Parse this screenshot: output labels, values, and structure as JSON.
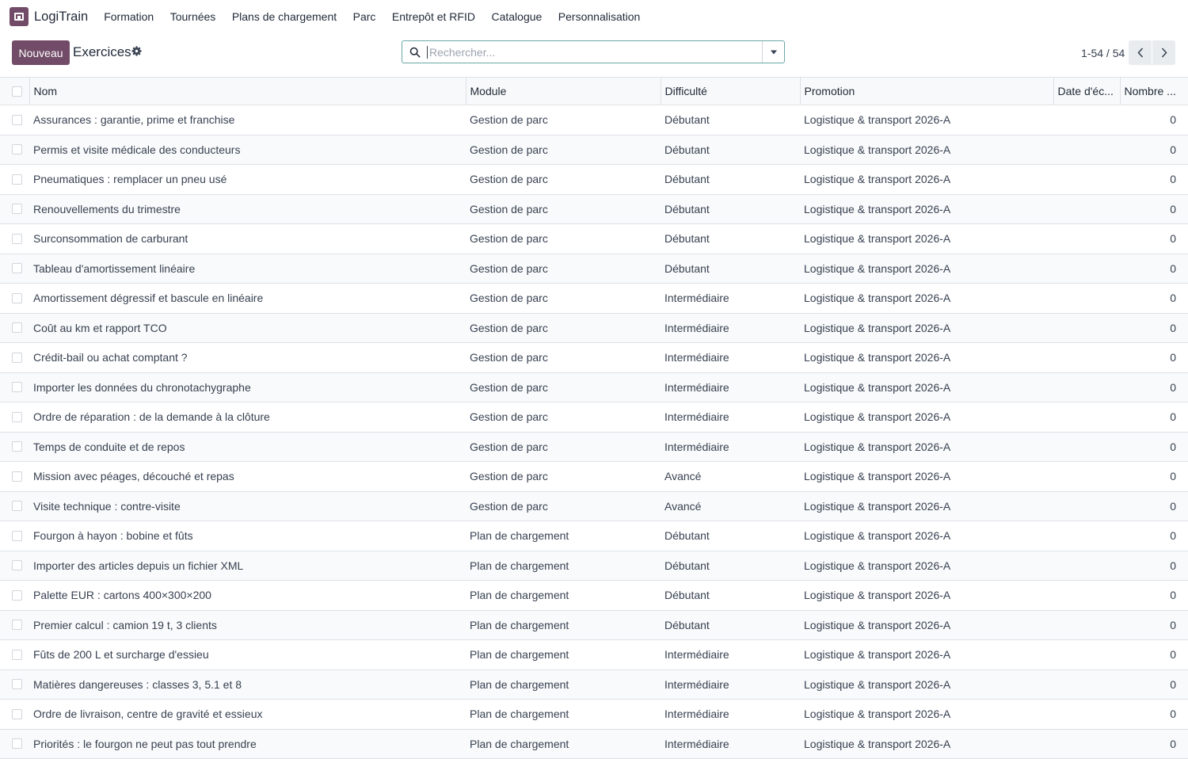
{
  "app": {
    "name": "LogiTrain"
  },
  "nav": [
    "Formation",
    "Tournées",
    "Plans de chargement",
    "Parc",
    "Entrepôt et RFID",
    "Catalogue",
    "Personnalisation"
  ],
  "control": {
    "new_label": "Nouveau",
    "title": "Exercices",
    "search_placeholder": "Rechercher...",
    "pager": "1-54 / 54"
  },
  "table": {
    "columns": [
      "Nom",
      "Module",
      "Difficulté",
      "Promotion",
      "Date d'éc...",
      "Nombre ..."
    ],
    "rows": [
      {
        "nom": "Assurances : garantie, prime et franchise",
        "module": "Gestion de parc",
        "difficulte": "Débutant",
        "promotion": "Logistique & transport 2026-A",
        "date": "",
        "nombre": "0"
      },
      {
        "nom": "Permis et visite médicale des conducteurs",
        "module": "Gestion de parc",
        "difficulte": "Débutant",
        "promotion": "Logistique & transport 2026-A",
        "date": "",
        "nombre": "0"
      },
      {
        "nom": "Pneumatiques : remplacer un pneu usé",
        "module": "Gestion de parc",
        "difficulte": "Débutant",
        "promotion": "Logistique & transport 2026-A",
        "date": "",
        "nombre": "0"
      },
      {
        "nom": "Renouvellements du trimestre",
        "module": "Gestion de parc",
        "difficulte": "Débutant",
        "promotion": "Logistique & transport 2026-A",
        "date": "",
        "nombre": "0"
      },
      {
        "nom": "Surconsommation de carburant",
        "module": "Gestion de parc",
        "difficulte": "Débutant",
        "promotion": "Logistique & transport 2026-A",
        "date": "",
        "nombre": "0"
      },
      {
        "nom": "Tableau d'amortissement linéaire",
        "module": "Gestion de parc",
        "difficulte": "Débutant",
        "promotion": "Logistique & transport 2026-A",
        "date": "",
        "nombre": "0"
      },
      {
        "nom": "Amortissement dégressif et bascule en linéaire",
        "module": "Gestion de parc",
        "difficulte": "Intermédiaire",
        "promotion": "Logistique & transport 2026-A",
        "date": "",
        "nombre": "0"
      },
      {
        "nom": "Coût au km et rapport TCO",
        "module": "Gestion de parc",
        "difficulte": "Intermédiaire",
        "promotion": "Logistique & transport 2026-A",
        "date": "",
        "nombre": "0"
      },
      {
        "nom": "Crédit-bail ou achat comptant ?",
        "module": "Gestion de parc",
        "difficulte": "Intermédiaire",
        "promotion": "Logistique & transport 2026-A",
        "date": "",
        "nombre": "0"
      },
      {
        "nom": "Importer les données du chronotachygraphe",
        "module": "Gestion de parc",
        "difficulte": "Intermédiaire",
        "promotion": "Logistique & transport 2026-A",
        "date": "",
        "nombre": "0"
      },
      {
        "nom": "Ordre de réparation : de la demande à la clôture",
        "module": "Gestion de parc",
        "difficulte": "Intermédiaire",
        "promotion": "Logistique & transport 2026-A",
        "date": "",
        "nombre": "0"
      },
      {
        "nom": "Temps de conduite et de repos",
        "module": "Gestion de parc",
        "difficulte": "Intermédiaire",
        "promotion": "Logistique & transport 2026-A",
        "date": "",
        "nombre": "0"
      },
      {
        "nom": "Mission avec péages, découché et repas",
        "module": "Gestion de parc",
        "difficulte": "Avancé",
        "promotion": "Logistique & transport 2026-A",
        "date": "",
        "nombre": "0"
      },
      {
        "nom": "Visite technique : contre-visite",
        "module": "Gestion de parc",
        "difficulte": "Avancé",
        "promotion": "Logistique & transport 2026-A",
        "date": "",
        "nombre": "0"
      },
      {
        "nom": "Fourgon à hayon : bobine et fûts",
        "module": "Plan de chargement",
        "difficulte": "Débutant",
        "promotion": "Logistique & transport 2026-A",
        "date": "",
        "nombre": "0"
      },
      {
        "nom": "Importer des articles depuis un fichier XML",
        "module": "Plan de chargement",
        "difficulte": "Débutant",
        "promotion": "Logistique & transport 2026-A",
        "date": "",
        "nombre": "0"
      },
      {
        "nom": "Palette EUR : cartons 400×300×200",
        "module": "Plan de chargement",
        "difficulte": "Débutant",
        "promotion": "Logistique & transport 2026-A",
        "date": "",
        "nombre": "0"
      },
      {
        "nom": "Premier calcul : camion 19 t, 3 clients",
        "module": "Plan de chargement",
        "difficulte": "Débutant",
        "promotion": "Logistique & transport 2026-A",
        "date": "",
        "nombre": "0"
      },
      {
        "nom": "Fûts de 200 L et surcharge d'essieu",
        "module": "Plan de chargement",
        "difficulte": "Intermédiaire",
        "promotion": "Logistique & transport 2026-A",
        "date": "",
        "nombre": "0"
      },
      {
        "nom": "Matières dangereuses : classes 3, 5.1 et 8",
        "module": "Plan de chargement",
        "difficulte": "Intermédiaire",
        "promotion": "Logistique & transport 2026-A",
        "date": "",
        "nombre": "0"
      },
      {
        "nom": "Ordre de livraison, centre de gravité et essieux",
        "module": "Plan de chargement",
        "difficulte": "Intermédiaire",
        "promotion": "Logistique & transport 2026-A",
        "date": "",
        "nombre": "0"
      },
      {
        "nom": "Priorités : le fourgon ne peut pas tout prendre",
        "module": "Plan de chargement",
        "difficulte": "Intermédiaire",
        "promotion": "Logistique & transport 2026-A",
        "date": "",
        "nombre": "0"
      }
    ]
  }
}
